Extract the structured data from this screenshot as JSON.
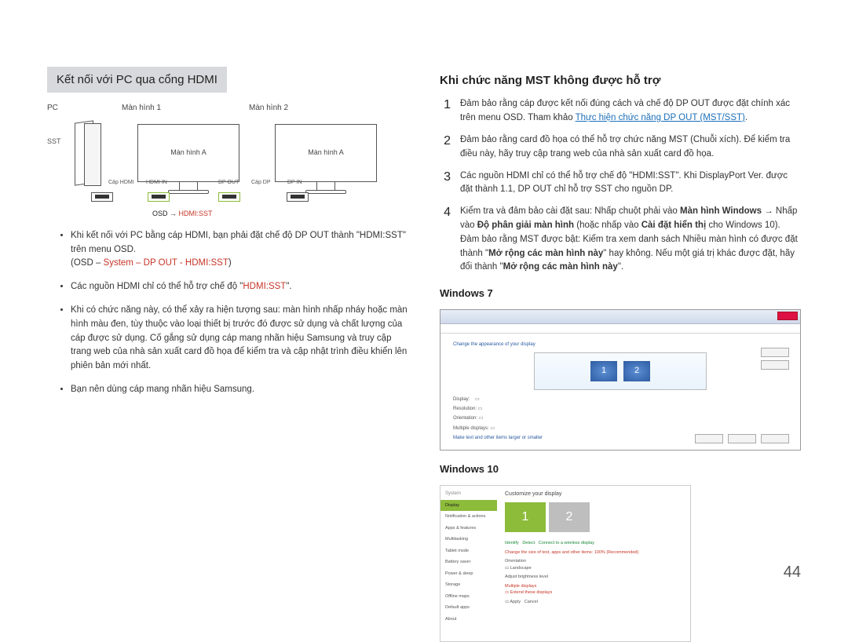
{
  "left": {
    "heading": "Kết nối với PC qua cổng HDMI",
    "diagram": {
      "col_pc": "PC",
      "col_m1": "Màn hình 1",
      "col_m2": "Màn hình 2",
      "sst": "SST",
      "screen_a": "Màn hình A",
      "screen_b": "Màn hình A",
      "cable_hdmi": "Cáp HDMI",
      "hdmi_in": "HDMI IN",
      "dp_out": "DP OUT",
      "cable_dp": "Cáp DP",
      "dp_in": "DP IN",
      "osd_prefix": "OSD → ",
      "osd_red": "HDMI:SST"
    },
    "b1a": "Khi kết nối với PC bằng cáp HDMI, bạn phải đặt chế độ DP OUT thành \"HDMI:SST\" trên menu OSD.",
    "b1b_pre": "(OSD – ",
    "b1b_red": "System – DP OUT - HDMI:SST",
    "b1b_post": ")",
    "b2_pre": "Các nguồn HDMI chỉ có thể hỗ trợ chế độ \"",
    "b2_red": "HDMI:SST",
    "b2_post": "\".",
    "b3": "Khi có chức năng này, có thể xảy ra hiện tượng sau: màn hình nhấp nháy hoặc màn hình màu đen, tùy thuộc vào loại thiết bị trước đó được sử dụng và chất lượng của cáp được sử dụng. Cố gắng sử dụng cáp mang nhãn hiệu Samsung và truy cập trang web của nhà sản xuất card đồ họa để kiểm tra và cập nhật trình điều khiển lên phiên bản mới nhất.",
    "b4": "Bạn nên dùng cáp mang nhãn hiệu Samsung."
  },
  "right": {
    "heading": "Khi chức năng MST không được hỗ trợ",
    "n1a": "Đảm bảo rằng cáp được kết nối đúng cách và chế độ DP OUT được đặt chính xác trên menu OSD. Tham khảo ",
    "n1link": "Thực hiện chức năng DP OUT (MST/SST)",
    "n1b": ".",
    "n2": "Đảm bảo rằng card đồ họa có thể hỗ trợ chức năng MST (Chuỗi xích). Để kiểm tra điều này, hãy truy cập trang web của nhà sản xuất card đồ họa.",
    "n3": "Các nguồn HDMI chỉ có thể hỗ trợ chế độ \"HDMI:SST\". Khi DisplayPort Ver. được đặt thành 1.1, DP OUT chỉ hỗ trợ SST cho nguồn DP.",
    "n4_a": "Kiểm tra và đảm bảo cài đặt sau: Nhấp chuột phải vào ",
    "n4_b": "Màn hình Windows",
    "n4_c": " → Nhấp vào ",
    "n4_d": "Độ phân giải màn hình",
    "n4_e": " (hoặc nhấp vào ",
    "n4_f": "Cài đặt hiển thị",
    "n4_g": " cho Windows 10). Đảm bảo rằng MST được bật: Kiểm tra xem danh sách Nhiều màn hình có được đặt thành \"",
    "n4_h": "Mở rộng các màn hình này",
    "n4_i": "\" hay không. Nếu một giá trị khác được đặt, hãy đổi thành \"",
    "n4_j": "Mở rộng các màn hình này",
    "n4_k": "\".",
    "win7_title": "Windows 7",
    "win10_title": "Windows 10",
    "win10_side": [
      "System",
      "Display",
      "Notification & actions",
      "Apps & features",
      "Multitasking",
      "Tablet mode",
      "Battery saver",
      "Power & sleep",
      "Storage",
      "Offline maps",
      "Default apps",
      "About"
    ]
  },
  "page_number": "44"
}
